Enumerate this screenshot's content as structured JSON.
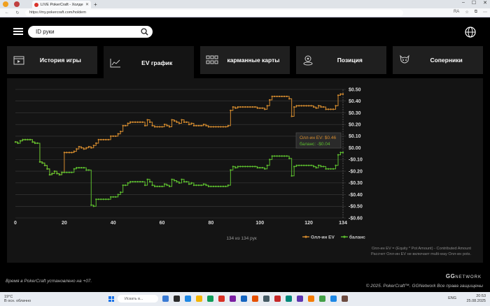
{
  "browser": {
    "tab_title": "LIVE PokerCraft - Холдем",
    "url": "https://my.pokercraft.com/holdem",
    "reader_mode": "RA"
  },
  "header": {
    "search_placeholder": "ID руки"
  },
  "tabs": [
    {
      "label": "История игры",
      "icon": "game-history-icon",
      "active": false
    },
    {
      "label": "EV график",
      "icon": "chart-line-icon",
      "active": true
    },
    {
      "label": "карманные карты",
      "icon": "grid-icon",
      "active": false
    },
    {
      "label": "Позиция",
      "icon": "position-icon",
      "active": false
    },
    {
      "label": "Соперники",
      "icon": "opponent-icon",
      "active": false
    }
  ],
  "chart_data": {
    "type": "line",
    "xlim": [
      0,
      134
    ],
    "ylim": [
      -0.6,
      0.5
    ],
    "x_ticks": [
      "0",
      "20",
      "40",
      "60",
      "80",
      "100",
      "120",
      "134"
    ],
    "y_ticks": [
      "$0.50",
      "$0.40",
      "$0.30",
      "$0.20",
      "$0.10",
      "$0.00",
      "-$0.10",
      "-$0.20",
      "-$0.30",
      "-$0.40",
      "-$0.50",
      "-$0.60"
    ],
    "y_tick_values": [
      0.5,
      0.4,
      0.3,
      0.2,
      0.1,
      0.0,
      -0.1,
      -0.2,
      -0.3,
      -0.4,
      -0.5,
      -0.6
    ],
    "x_tick_values": [
      0,
      20,
      40,
      60,
      80,
      100,
      120,
      134
    ],
    "grid": true,
    "series": [
      {
        "name": "Олл-ин EV",
        "color": "#d38a2e",
        "points": [
          [
            0,
            0.05
          ],
          [
            1,
            0.04
          ],
          [
            2,
            0.06
          ],
          [
            3,
            0.07
          ],
          [
            5,
            0.07
          ],
          [
            7,
            0.05
          ],
          [
            8,
            0.04
          ],
          [
            9,
            0.04
          ],
          [
            10,
            -0.12
          ],
          [
            11,
            -0.13
          ],
          [
            12,
            -0.15
          ],
          [
            13,
            -0.18
          ],
          [
            14,
            -0.23
          ],
          [
            15,
            -0.22
          ],
          [
            16,
            -0.2
          ],
          [
            17,
            -0.22
          ],
          [
            18,
            -0.23
          ],
          [
            19,
            -0.21
          ],
          [
            20,
            -0.04
          ],
          [
            23,
            -0.04
          ],
          [
            24,
            -0.03
          ],
          [
            25,
            -0.01
          ],
          [
            26,
            0.01
          ],
          [
            27,
            0.0
          ],
          [
            28,
            -0.01
          ],
          [
            29,
            0.0
          ],
          [
            30,
            0.01
          ],
          [
            31,
            0.0
          ],
          [
            32,
            0.02
          ],
          [
            33,
            0.04
          ],
          [
            34,
            0.07
          ],
          [
            38,
            0.07
          ],
          [
            39,
            0.1
          ],
          [
            41,
            0.1
          ],
          [
            42,
            0.12
          ],
          [
            43,
            0.14
          ],
          [
            44,
            0.19
          ],
          [
            45,
            0.19
          ],
          [
            46,
            0.21
          ],
          [
            47,
            0.22
          ],
          [
            52,
            0.22
          ],
          [
            53,
            0.19
          ],
          [
            54,
            0.24
          ],
          [
            55,
            0.22
          ],
          [
            56,
            0.19
          ],
          [
            57,
            0.18
          ],
          [
            60,
            0.18
          ],
          [
            61,
            0.2
          ],
          [
            62,
            0.19
          ],
          [
            63,
            0.18
          ],
          [
            64,
            0.24
          ],
          [
            65,
            0.23
          ],
          [
            66,
            0.22
          ],
          [
            67,
            0.21
          ],
          [
            68,
            0.24
          ],
          [
            69,
            0.22
          ],
          [
            70,
            0.22
          ],
          [
            71,
            0.2
          ],
          [
            72,
            0.21
          ],
          [
            73,
            0.19
          ],
          [
            76,
            0.19
          ],
          [
            77,
            0.2
          ],
          [
            78,
            0.19
          ],
          [
            79,
            0.18
          ],
          [
            86,
            0.18
          ],
          [
            87,
            0.19
          ],
          [
            88,
            0.32
          ],
          [
            89,
            0.35
          ],
          [
            90,
            0.34
          ],
          [
            91,
            0.35
          ],
          [
            98,
            0.35
          ],
          [
            99,
            0.34
          ],
          [
            101,
            0.34
          ],
          [
            102,
            0.33
          ],
          [
            103,
            0.36
          ],
          [
            104,
            0.41
          ],
          [
            105,
            0.44
          ],
          [
            111,
            0.44
          ],
          [
            112,
            0.42
          ],
          [
            113,
            0.27
          ],
          [
            114,
            0.35
          ],
          [
            115,
            0.36
          ],
          [
            121,
            0.36
          ],
          [
            122,
            0.35
          ],
          [
            123,
            0.34
          ],
          [
            124,
            0.36
          ],
          [
            125,
            0.35
          ],
          [
            127,
            0.33
          ],
          [
            130,
            0.33
          ],
          [
            131,
            0.36
          ],
          [
            132,
            0.45
          ],
          [
            133,
            0.46
          ],
          [
            134,
            0.46
          ]
        ]
      },
      {
        "name": "баланс",
        "color": "#5cbd2e",
        "points": [
          [
            0,
            0.05
          ],
          [
            1,
            0.04
          ],
          [
            2,
            0.06
          ],
          [
            3,
            0.07
          ],
          [
            5,
            0.07
          ],
          [
            7,
            0.05
          ],
          [
            8,
            0.04
          ],
          [
            9,
            0.04
          ],
          [
            10,
            -0.12
          ],
          [
            11,
            -0.13
          ],
          [
            12,
            -0.15
          ],
          [
            13,
            -0.18
          ],
          [
            14,
            -0.23
          ],
          [
            15,
            -0.22
          ],
          [
            16,
            -0.2
          ],
          [
            17,
            -0.22
          ],
          [
            18,
            -0.23
          ],
          [
            19,
            -0.21
          ],
          [
            20,
            -0.21
          ],
          [
            23,
            -0.21
          ],
          [
            24,
            -0.18
          ],
          [
            25,
            -0.17
          ],
          [
            28,
            -0.17
          ],
          [
            29,
            -0.19
          ],
          [
            30,
            -0.19
          ],
          [
            31,
            -0.49
          ],
          [
            32,
            -0.5
          ],
          [
            33,
            -0.44
          ],
          [
            38,
            -0.44
          ],
          [
            39,
            -0.42
          ],
          [
            41,
            -0.42
          ],
          [
            42,
            -0.4
          ],
          [
            43,
            -0.38
          ],
          [
            44,
            -0.32
          ],
          [
            45,
            -0.32
          ],
          [
            46,
            -0.3
          ],
          [
            47,
            -0.29
          ],
          [
            52,
            -0.29
          ],
          [
            53,
            -0.32
          ],
          [
            54,
            -0.27
          ],
          [
            55,
            -0.29
          ],
          [
            56,
            -0.32
          ],
          [
            57,
            -0.33
          ],
          [
            60,
            -0.33
          ],
          [
            61,
            -0.31
          ],
          [
            62,
            -0.32
          ],
          [
            63,
            -0.33
          ],
          [
            64,
            -0.27
          ],
          [
            65,
            -0.28
          ],
          [
            66,
            -0.29
          ],
          [
            67,
            -0.3
          ],
          [
            68,
            -0.27
          ],
          [
            69,
            -0.29
          ],
          [
            70,
            -0.29
          ],
          [
            71,
            -0.31
          ],
          [
            72,
            -0.3
          ],
          [
            73,
            -0.32
          ],
          [
            76,
            -0.32
          ],
          [
            77,
            -0.31
          ],
          [
            78,
            -0.32
          ],
          [
            79,
            -0.33
          ],
          [
            86,
            -0.33
          ],
          [
            87,
            -0.32
          ],
          [
            88,
            -0.19
          ],
          [
            89,
            -0.16
          ],
          [
            90,
            -0.17
          ],
          [
            91,
            -0.16
          ],
          [
            98,
            -0.16
          ],
          [
            99,
            -0.17
          ],
          [
            101,
            -0.17
          ],
          [
            102,
            -0.18
          ],
          [
            103,
            -0.15
          ],
          [
            104,
            -0.1
          ],
          [
            105,
            -0.07
          ],
          [
            111,
            -0.07
          ],
          [
            112,
            -0.09
          ],
          [
            113,
            -0.24
          ],
          [
            114,
            -0.16
          ],
          [
            115,
            -0.15
          ],
          [
            121,
            -0.15
          ],
          [
            122,
            -0.16
          ],
          [
            123,
            -0.17
          ],
          [
            124,
            -0.15
          ],
          [
            125,
            -0.16
          ],
          [
            127,
            -0.18
          ],
          [
            130,
            -0.18
          ],
          [
            131,
            -0.15
          ],
          [
            132,
            -0.06
          ],
          [
            133,
            -0.04
          ],
          [
            134,
            -0.04
          ]
        ]
      }
    ],
    "tooltip": {
      "ev_label": "Олл-ин EV: $0.46",
      "balance_label": "баланс: -$0.04"
    },
    "hand_count": "134 из 134 рук",
    "legend": [
      "Олл-ин EV",
      "баланс"
    ],
    "legend_position": "bottom-right",
    "note_line1": "Олл-ин EV = (Equity * Pot Amount) - Contributed Amount",
    "note_line2": "Рассчет Олл-ин EV не включает multi-way Олл-ин pots."
  },
  "footer": {
    "timezone_note": "Время в PokerCraft установлено на +07.",
    "copyright": "© 2025. PokerCraft™. GGNetwork Все права защищены",
    "brand": "GG",
    "brand_suffix": "NETWORK"
  },
  "taskbar": {
    "weather_temp": "19°C",
    "weather_desc": "В осн. облачно",
    "search_placeholder": "Искать в...",
    "lang": "ENG",
    "time": "20:53",
    "date": "25.08.2025"
  }
}
